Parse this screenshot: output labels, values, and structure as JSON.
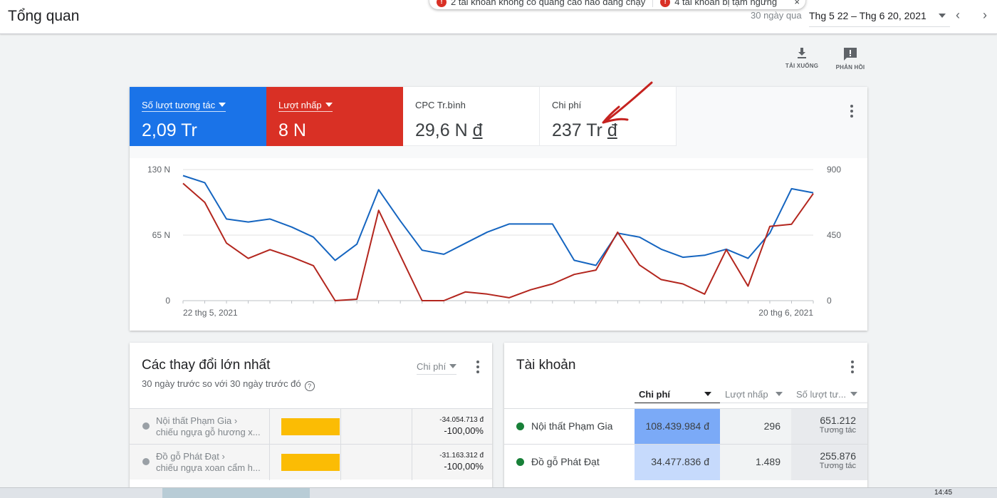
{
  "header": {
    "title": "Tổng quan",
    "alerts": [
      {
        "text": "2 tài khoản không có quảng cáo nào đang chạy",
        "icon": "error-icon"
      },
      {
        "text": "4 tài khoản bị tạm ngừng",
        "icon": "error-icon"
      }
    ],
    "alert_close": "×",
    "range_label": "30 ngày qua",
    "date_range": "Thg 5 22 – Thg 6 20, 2021",
    "prev_arrow": "‹",
    "next_arrow": "›"
  },
  "toolbar": {
    "download_label": "TẢI XUỐNG",
    "feedback_label": "PHẢN HỒI"
  },
  "metrics": [
    {
      "label": "Số lượt tương tác",
      "value": "2,09 Tr",
      "color": "#1a73e8"
    },
    {
      "label": "Lượt nhấp",
      "value": "8 N",
      "color": "#d93025"
    },
    {
      "label": "CPC Tr.bình",
      "value_main": "29,6 N",
      "currency": "đ"
    },
    {
      "label": "Chi phí",
      "value_main": "237 Tr",
      "currency": "đ"
    }
  ],
  "chart_data": {
    "type": "line",
    "x_start_label": "22 thg 5, 2021",
    "x_end_label": "20 thg 6, 2021",
    "left_ticks": [
      "130 N",
      "65 N",
      "0"
    ],
    "right_ticks": [
      "900",
      "450",
      "0"
    ],
    "left_axis_range": [
      0,
      130000
    ],
    "right_axis_range": [
      0,
      900
    ],
    "series": [
      {
        "name": "Số lượt tương tác",
        "axis": "left",
        "color": "#1565c0",
        "values": [
          124000,
          117000,
          81000,
          78000,
          81000,
          73000,
          63000,
          40000,
          56000,
          110000,
          79000,
          50000,
          46000,
          57000,
          68000,
          76000,
          76000,
          76000,
          40000,
          35000,
          67000,
          63000,
          51000,
          43000,
          45000,
          51000,
          42000,
          67000,
          111000,
          107000
        ]
      },
      {
        "name": "Lượt nhấp",
        "axis": "right",
        "color": "#b3261e",
        "values": [
          805,
          675,
          395,
          290,
          350,
          300,
          240,
          0,
          10,
          620,
          310,
          0,
          0,
          60,
          45,
          20,
          75,
          115,
          180,
          210,
          470,
          245,
          145,
          115,
          45,
          350,
          100,
          510,
          525,
          735
        ]
      }
    ]
  },
  "changes": {
    "title": "Các thay đổi lớn nhất",
    "subtitle": "30 ngày trước so với 30 ngày trước đó",
    "selector": "Chi phí",
    "rows": [
      {
        "line1": "Nội thất Phạm Gia ›",
        "line2": "chiếu ngựa gỗ hương x...",
        "amount": "-34.054.713 đ",
        "percent": "-100,00%"
      },
      {
        "line1": "Đồ gỗ Phát Đạt ›",
        "line2": "chiếu ngựa xoan cẩm h...",
        "amount": "-31.163.312 đ",
        "percent": "-100,00%"
      }
    ]
  },
  "accounts": {
    "title": "Tài khoản",
    "columns": [
      "Chi phí",
      "Lượt nhấp",
      "Số lượt tư..."
    ],
    "rows": [
      {
        "name": "Nội thất Phạm Gia",
        "cost": "108.439.984 đ",
        "clicks": "296",
        "interactions": "651.212",
        "interaction_label": "Tương tác",
        "cost_bg": "#7baaf7"
      },
      {
        "name": "Đồ gỗ Phát Đạt",
        "cost": "34.477.836 đ",
        "clicks": "1.489",
        "interactions": "255.876",
        "interaction_label": "Tương tác",
        "cost_bg": "#c6dafc"
      }
    ]
  },
  "taskbar": {
    "clock": "14:45"
  }
}
